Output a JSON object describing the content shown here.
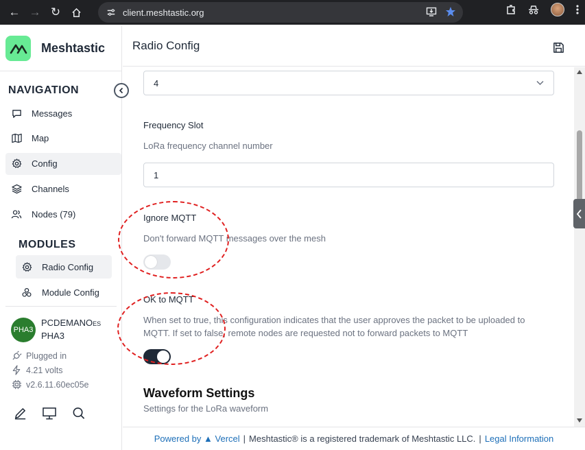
{
  "browser": {
    "url": "client.meshtastic.org"
  },
  "app": {
    "name": "Meshtastic",
    "page_title": "Radio Config"
  },
  "sidebar": {
    "navigation_title": "NAVIGATION",
    "nav_items": [
      {
        "label": "Messages",
        "icon": "message-icon"
      },
      {
        "label": "Map",
        "icon": "map-icon"
      },
      {
        "label": "Config",
        "icon": "gear-icon",
        "active": true
      },
      {
        "label": "Channels",
        "icon": "layers-icon"
      },
      {
        "label": "Nodes (79)",
        "icon": "users-icon"
      }
    ],
    "modules_title": "MODULES",
    "module_items": [
      {
        "label": "Radio Config",
        "icon": "gear-icon",
        "active": true
      },
      {
        "label": "Module Config",
        "icon": "boxes-icon"
      }
    ]
  },
  "device": {
    "badge": "PHA3",
    "name_prefix": "PCDEMANO",
    "name_suffix": "ES",
    "short_name": "PHA3",
    "power": "Plugged in",
    "voltage": "4.21 volts",
    "firmware": "v2.6.11.60ec05e"
  },
  "form": {
    "previous_select_value": "4",
    "frequency_slot": {
      "label": "Frequency Slot",
      "description": "LoRa frequency channel number",
      "value": "1"
    },
    "ignore_mqtt": {
      "label": "Ignore MQTT",
      "description": "Don't forward MQTT messages over the mesh",
      "enabled": false
    },
    "ok_to_mqtt": {
      "label": "OK to MQTT",
      "description_line1": "When set to true, this configuration indicates that the user approves the packet to be uploaded to",
      "description_line2": "MQTT. If set to false, remote nodes are requested not to forward packets to MQTT",
      "enabled": true
    },
    "waveform": {
      "heading": "Waveform Settings",
      "description": "Settings for the LoRa waveform"
    }
  },
  "footer": {
    "powered_by": "Powered by",
    "vercel": "Vercel",
    "trademark": "Meshtastic® is a registered trademark of Meshtastic LLC.",
    "legal": "Legal Information"
  },
  "colors": {
    "logo": "#67ea94",
    "badge": "#2a7d2e",
    "annotation": "#e02020",
    "link": "#1d6fb8"
  }
}
